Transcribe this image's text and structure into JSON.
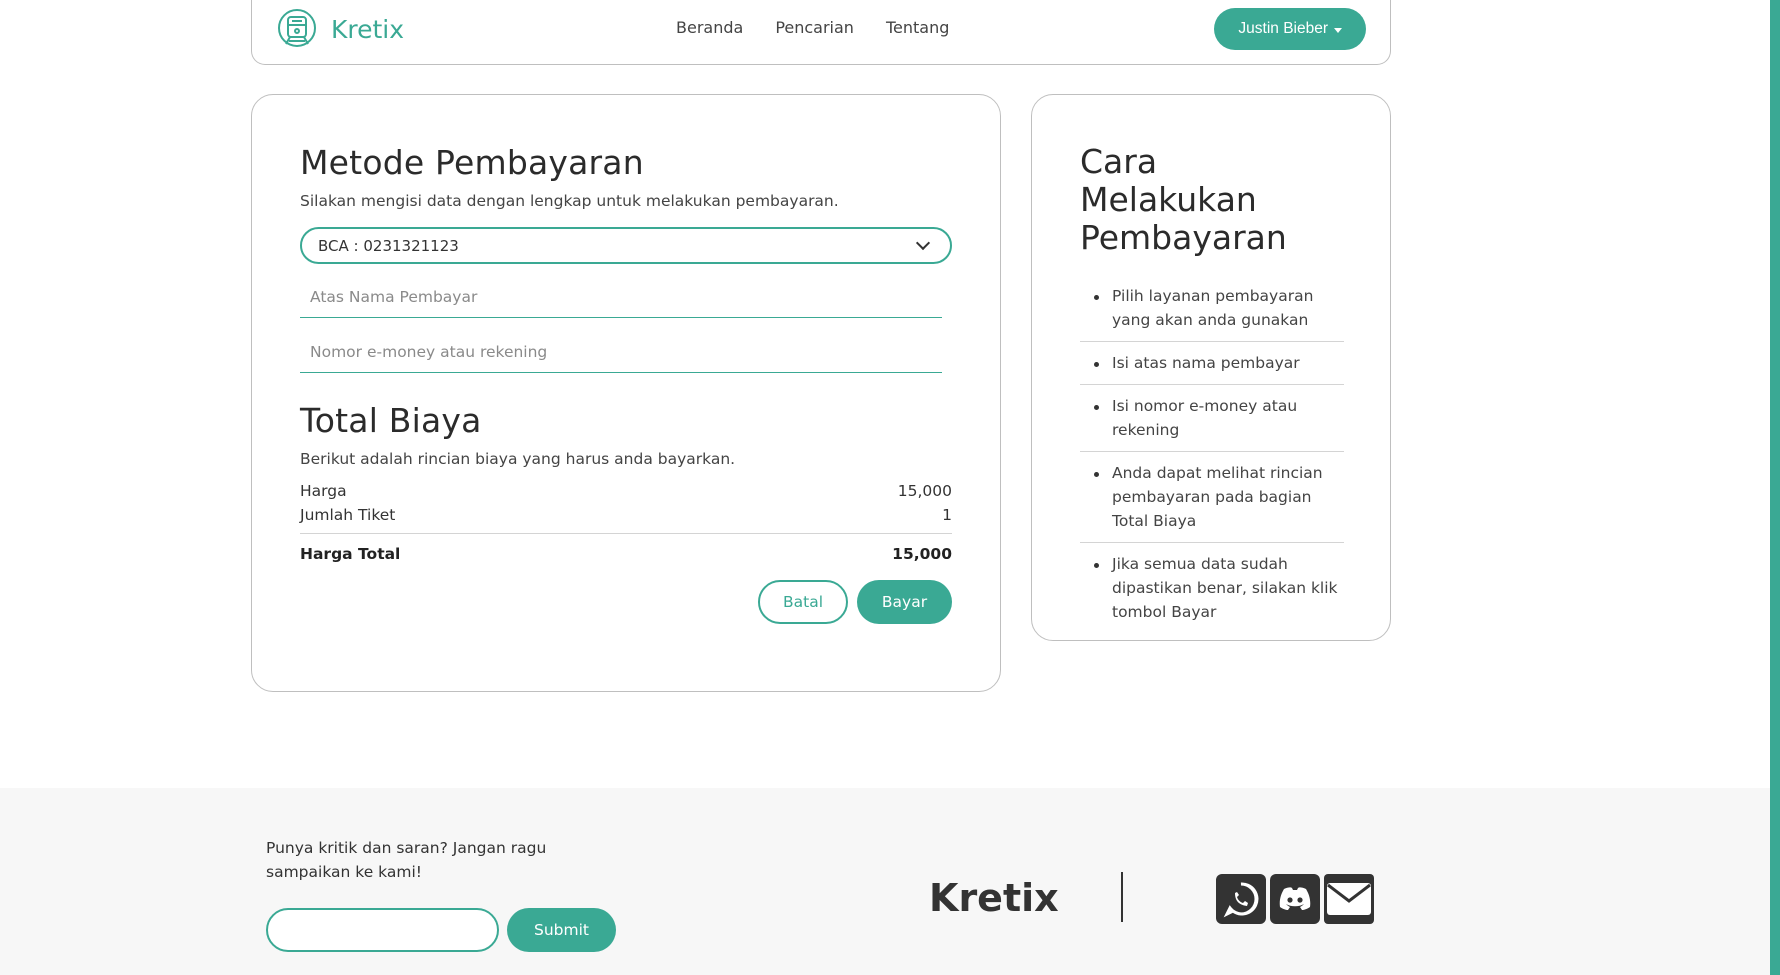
{
  "header": {
    "brand": "Kretix",
    "nav": [
      "Beranda",
      "Pencarian",
      "Tentang"
    ],
    "user": "Justin Bieber"
  },
  "payment": {
    "title": "Metode Pembayaran",
    "subtitle": "Silakan mengisi data dengan lengkap untuk melakukan pembayaran.",
    "method_selected": "BCA : 0231321123",
    "payer_name_placeholder": "Atas Nama Pembayar",
    "account_placeholder": "Nomor e-money atau rekening"
  },
  "total": {
    "title": "Total Biaya",
    "subtitle": "Berikut adalah rincian biaya yang harus anda bayarkan.",
    "price_label": "Harga",
    "price_value": "15,000",
    "qty_label": "Jumlah Tiket",
    "qty_value": "1",
    "total_label": "Harga Total",
    "total_value": "15,000",
    "cancel_label": "Batal",
    "pay_label": "Bayar"
  },
  "guide": {
    "title": "Cara Melakukan Pembayaran",
    "steps": [
      "Pilih layanan pembayaran yang akan anda gunakan",
      "Isi atas nama pembayar",
      "Isi nomor e-money atau rekening",
      "Anda dapat melihat rincian pembayaran pada bagian Total Biaya",
      "Jika semua data sudah dipastikan benar, silakan klik tombol Bayar"
    ]
  },
  "footer": {
    "feedback_text": "Punya kritik dan saran? Jangan ragu sampaikan ke kami!",
    "submit_label": "Submit",
    "brand": "Kretix",
    "socials": [
      "whatsapp-icon",
      "discord-icon",
      "mail-icon"
    ]
  },
  "colors": {
    "accent": "#3aa994",
    "footer_bg": "#f7f7f7",
    "text": "#2b2b2b"
  }
}
